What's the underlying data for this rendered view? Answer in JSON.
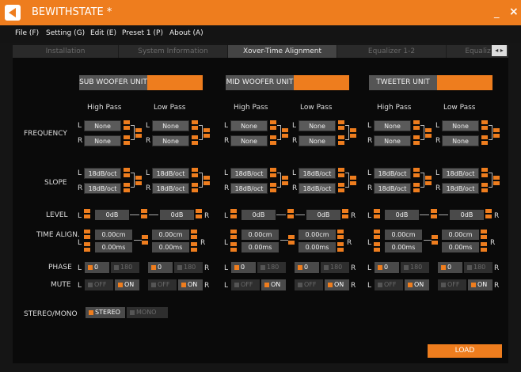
{
  "window": {
    "title": "BEWITHSTATE *",
    "minimize": "_",
    "close": "×"
  },
  "menu": [
    "File (F)",
    "Setting (G)",
    "Edit (E)",
    "Preset 1 (P)",
    "About (A)"
  ],
  "tabs": [
    "Installation",
    "System Information",
    "Xover-Time Alignment",
    "Equalizer 1-2",
    "Equaliz"
  ],
  "tab_scroll": "◂ ▸",
  "rows": {
    "frequency": "FREQUENCY",
    "slope": "SLOPE",
    "level": "LEVEL",
    "time": "TIME ALIGN.",
    "phase": "PHASE",
    "mute": "MUTE",
    "stereo": "STEREO/MONO"
  },
  "columns": {
    "high": "High Pass",
    "low": "Low Pass"
  },
  "ch": {
    "l": "L",
    "r": "R"
  },
  "units": {
    "sub": {
      "title": "SUB WOOFER UNIT"
    },
    "mid": {
      "title": "MID WOOFER UNIT"
    },
    "tw": {
      "title": "TWEETER UNIT"
    }
  },
  "values": {
    "freq": "None",
    "slope": "18dB/oct",
    "level": "0dB",
    "time_cm": "0.00cm",
    "time_ms": "0.00ms",
    "phase0": "0",
    "phase180": "180",
    "off": "OFF",
    "on": "ON",
    "stereo": "STEREO",
    "mono": "MONO"
  },
  "load": "LOAD",
  "accent": "#ee7d1e"
}
